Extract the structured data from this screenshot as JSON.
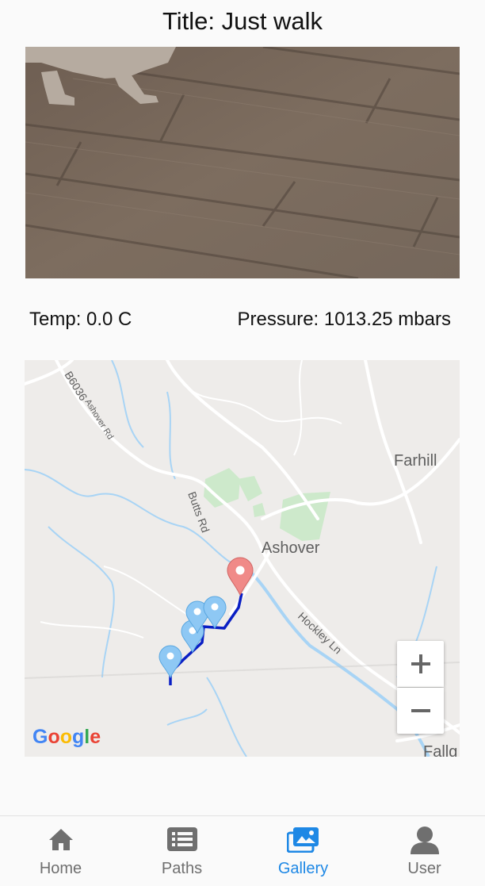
{
  "post": {
    "title": "Title: Just walk"
  },
  "readings": {
    "temperature": "Temp: 0.0 C",
    "pressure": "Pressure: 1013.25 mbars"
  },
  "map": {
    "road_b6036": "B6036",
    "road_ashover_rd": "Ashover Rd",
    "road_butts_rd": "Butts Rd",
    "road_hockley_ln": "Hockley Ln",
    "place_farhill": "Farhill",
    "place_ashover": "Ashover",
    "place_fallgate": "Fallg",
    "attribution": "Google",
    "zoom_in_icon": "plus-icon",
    "zoom_out_icon": "minus-icon",
    "route_color": "#0a1fc4",
    "start_marker_color": "#f08a88",
    "waypoint_marker_color": "#8ec8f4"
  },
  "nav": {
    "tabs": [
      {
        "label": "Home",
        "icon": "home-icon"
      },
      {
        "label": "Paths",
        "icon": "list-icon"
      },
      {
        "label": "Gallery",
        "icon": "gallery-icon"
      },
      {
        "label": "User",
        "icon": "user-icon"
      }
    ],
    "active_color": "#1e88e5",
    "inactive_color": "#6f6f6f"
  }
}
